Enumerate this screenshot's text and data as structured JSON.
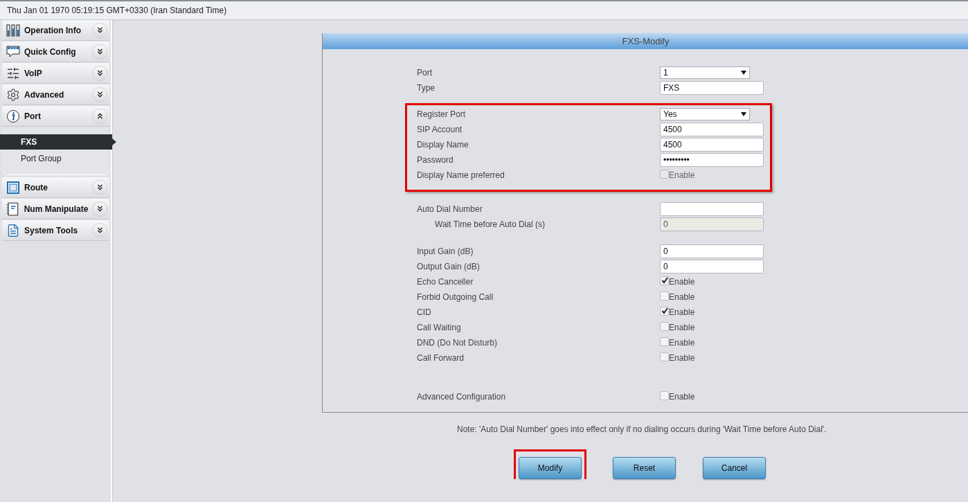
{
  "top_bar": {
    "datetime": "Thu Jan 01 1970 05:19:15 GMT+0330 (Iran Standard Time)"
  },
  "sidebar": {
    "items": [
      {
        "label": "Operation Info",
        "expanded": false
      },
      {
        "label": "Quick Config",
        "expanded": false
      },
      {
        "label": "VoIP",
        "expanded": false
      },
      {
        "label": "Advanced",
        "expanded": false
      },
      {
        "label": "Port",
        "expanded": true,
        "children": [
          {
            "label": "FXS",
            "selected": true
          },
          {
            "label": "Port Group",
            "selected": false
          }
        ]
      },
      {
        "label": "Route",
        "expanded": false
      },
      {
        "label": "Num Manipulate",
        "expanded": false
      },
      {
        "label": "System Tools",
        "expanded": false
      }
    ]
  },
  "panel": {
    "title": "FXS-Modify",
    "sections": [
      {
        "highlighted": false,
        "rows": [
          {
            "kind": "select",
            "label": "Port",
            "value": "1"
          },
          {
            "kind": "text",
            "label": "Type",
            "value": "FXS"
          }
        ]
      },
      {
        "highlighted": true,
        "rows": [
          {
            "kind": "select",
            "label": "Register Port",
            "value": "Yes"
          },
          {
            "kind": "text",
            "label": "SIP Account",
            "value": "4500"
          },
          {
            "kind": "text",
            "label": "Display Name",
            "value": "4500"
          },
          {
            "kind": "text",
            "label": "Password",
            "value": "•••••••••"
          },
          {
            "kind": "checkbox",
            "label": "Display Name preferred",
            "checked": false,
            "disabled": true,
            "option": "Enable"
          }
        ]
      },
      {
        "highlighted": false,
        "rows": [
          {
            "kind": "text",
            "label": "Auto Dial Number"
          },
          {
            "kind": "text",
            "label": "Wait Time before Auto Dial (s)",
            "value": "0",
            "disabled": true
          }
        ]
      },
      {
        "highlighted": false,
        "rows": [
          {
            "kind": "text",
            "label": "Input Gain (dB)",
            "value": "0"
          },
          {
            "kind": "text",
            "label": "Output Gain (dB)",
            "value": "0"
          },
          {
            "kind": "checkbox",
            "label": "Echo Canceller",
            "checked": true,
            "disabled": false,
            "option": "Enable"
          },
          {
            "kind": "checkbox",
            "label": "Forbid Outgoing Call",
            "checked": false,
            "disabled": false,
            "option": "Enable"
          },
          {
            "kind": "checkbox",
            "label": "CID",
            "checked": true,
            "disabled": false,
            "option": "Enable"
          },
          {
            "kind": "checkbox",
            "label": "Call Waiting",
            "checked": false,
            "disabled": false,
            "option": "Enable"
          },
          {
            "kind": "checkbox",
            "label": "DND (Do Not Disturb)",
            "checked": false,
            "disabled": false,
            "option": "Enable"
          },
          {
            "kind": "checkbox",
            "label": "Call Forward",
            "checked": false,
            "disabled": false,
            "option": "Enable"
          }
        ]
      },
      {
        "highlighted": false,
        "rows": [
          {
            "kind": "checkbox",
            "label": "Advanced Configuration",
            "checked": false,
            "disabled": false,
            "option": "Enable"
          }
        ]
      }
    ]
  },
  "note": "Note: 'Auto Dial Number' goes into effect only if no dialing occurs during 'Wait Time before Auto Dial'.",
  "buttons": [
    {
      "label": "Modify",
      "highlighted": true
    },
    {
      "label": "Reset",
      "highlighted": false
    },
    {
      "label": "Cancel",
      "highlighted": false
    }
  ]
}
